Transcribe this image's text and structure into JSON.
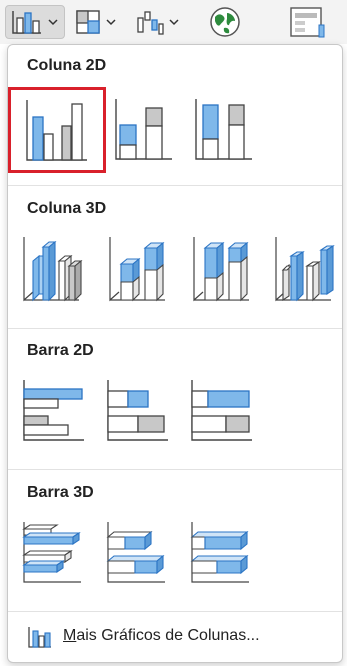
{
  "ribbon": {
    "buttons": [
      {
        "icon": "column-chart-icon",
        "active": true
      },
      {
        "icon": "treemap-chart-icon"
      },
      {
        "icon": "waterfall-chart-icon"
      },
      {
        "icon": "globe-map-icon"
      },
      {
        "icon": "pivot-chart-icon"
      }
    ]
  },
  "sections": {
    "coluna2d": {
      "title": "Coluna 2D"
    },
    "coluna3d": {
      "title": "Coluna 3D"
    },
    "barra2d": {
      "title": "Barra 2D"
    },
    "barra3d": {
      "title": "Barra 3D"
    }
  },
  "footer": {
    "accel": "M",
    "label_rest": "ais Gráficos de Colunas..."
  },
  "colors": {
    "accent_blue": "#7fb8ea",
    "blue_stroke": "#2b74c4",
    "selection_red": "#d9202b",
    "gray_fill": "#c8c8c8"
  }
}
